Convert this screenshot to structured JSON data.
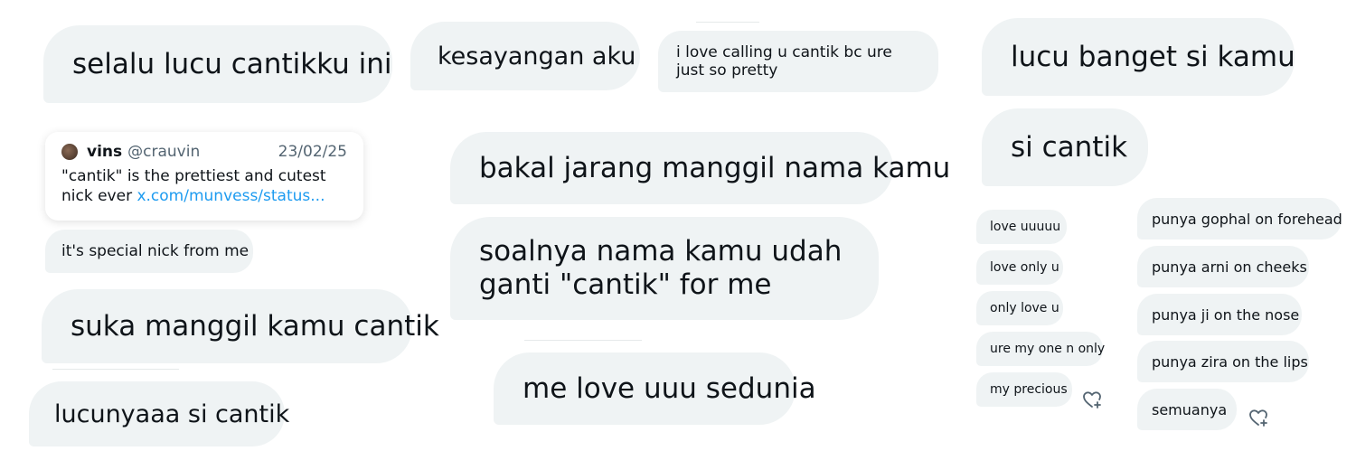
{
  "left_column": {
    "b1": "selalu lucu cantikku ini",
    "quote": {
      "name": "vins",
      "handle": "@crauvin",
      "date": "23/02/25",
      "text": "\"cantik\" is the prettiest and cutest nick ever ",
      "link": "x.com/munvess/status..."
    },
    "b2": "it's special nick from me",
    "b3": "suka manggil kamu cantik",
    "b4": "lucunyaaa si cantik"
  },
  "middle_column": {
    "b1": "kesayangan aku",
    "b2": "i love calling u cantik bc ure just so pretty",
    "b3": "bakal jarang manggil nama kamu",
    "b4": "soalnya nama kamu udah ganti \"cantik\" for me",
    "b5": "me love uuu sedunia"
  },
  "right_column": {
    "b1": "lucu banget si kamu",
    "b2": "si cantik",
    "small_left": [
      "love uuuuu",
      "love only u",
      "only love u",
      "ure my one n only",
      "my precious"
    ],
    "small_right": [
      "punya gophal on forehead",
      "punya arni on cheeks",
      "punya ji on the nose",
      "punya zira on the lips",
      "semuanya"
    ]
  },
  "icons": {
    "heart_add": "heart-plus-icon"
  },
  "colors": {
    "bubble": "#eff3f4",
    "link": "#1d9bf0",
    "muted": "#536471"
  }
}
